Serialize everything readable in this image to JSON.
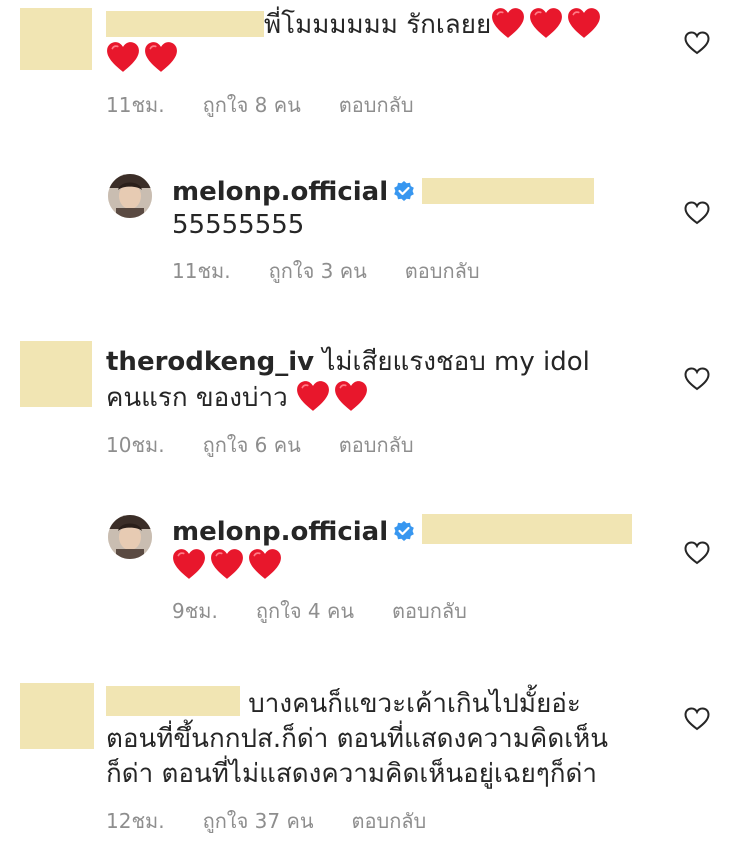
{
  "comments": [
    {
      "text_line1": "พี่โมมมมมม รักเลยย",
      "time": "11ชม.",
      "likes": "ถูกใจ 8 คน",
      "reply": "ตอบกลับ"
    },
    {
      "username": "melonp.official",
      "text": "55555555",
      "time": "11ชม.",
      "likes": "ถูกใจ 3 คน",
      "reply": "ตอบกลับ"
    },
    {
      "username": "therodkeng_iv",
      "text_line1": "ไม่เสียแรงชอบ my idol",
      "text_line2": "คนแรก ของบ่าว",
      "time": "10ชม.",
      "likes": "ถูกใจ 6 คน",
      "reply": "ตอบกลับ"
    },
    {
      "username": "melonp.official",
      "time": "9ชม.",
      "likes": "ถูกใจ 4 คน",
      "reply": "ตอบกลับ"
    },
    {
      "text_line1": "บางคนก็แขวะเค้าเกินไปมั้ยอ่ะ",
      "text_line2": "ตอนที่ขึ้นกกปส.ก็ด่า ตอนที่แสดงความคิดเห็น",
      "text_line3": "ก็ด่า ตอนที่ไม่แสดงความคิดเห็นอยู่เฉยๆก็ด่า",
      "time": "12ชม.",
      "likes": "ถูกใจ 37 คน",
      "reply": "ตอบกลับ"
    }
  ],
  "icons": {
    "heart_emoji": "red-heart-icon",
    "like": "heart-outline-icon",
    "verified": "verified-badge-icon"
  },
  "colors": {
    "text": "#262626",
    "meta": "#8e8e8e",
    "verified": "#3897f0",
    "heart": "#e8172c",
    "redaction": "#f1e5b3"
  }
}
